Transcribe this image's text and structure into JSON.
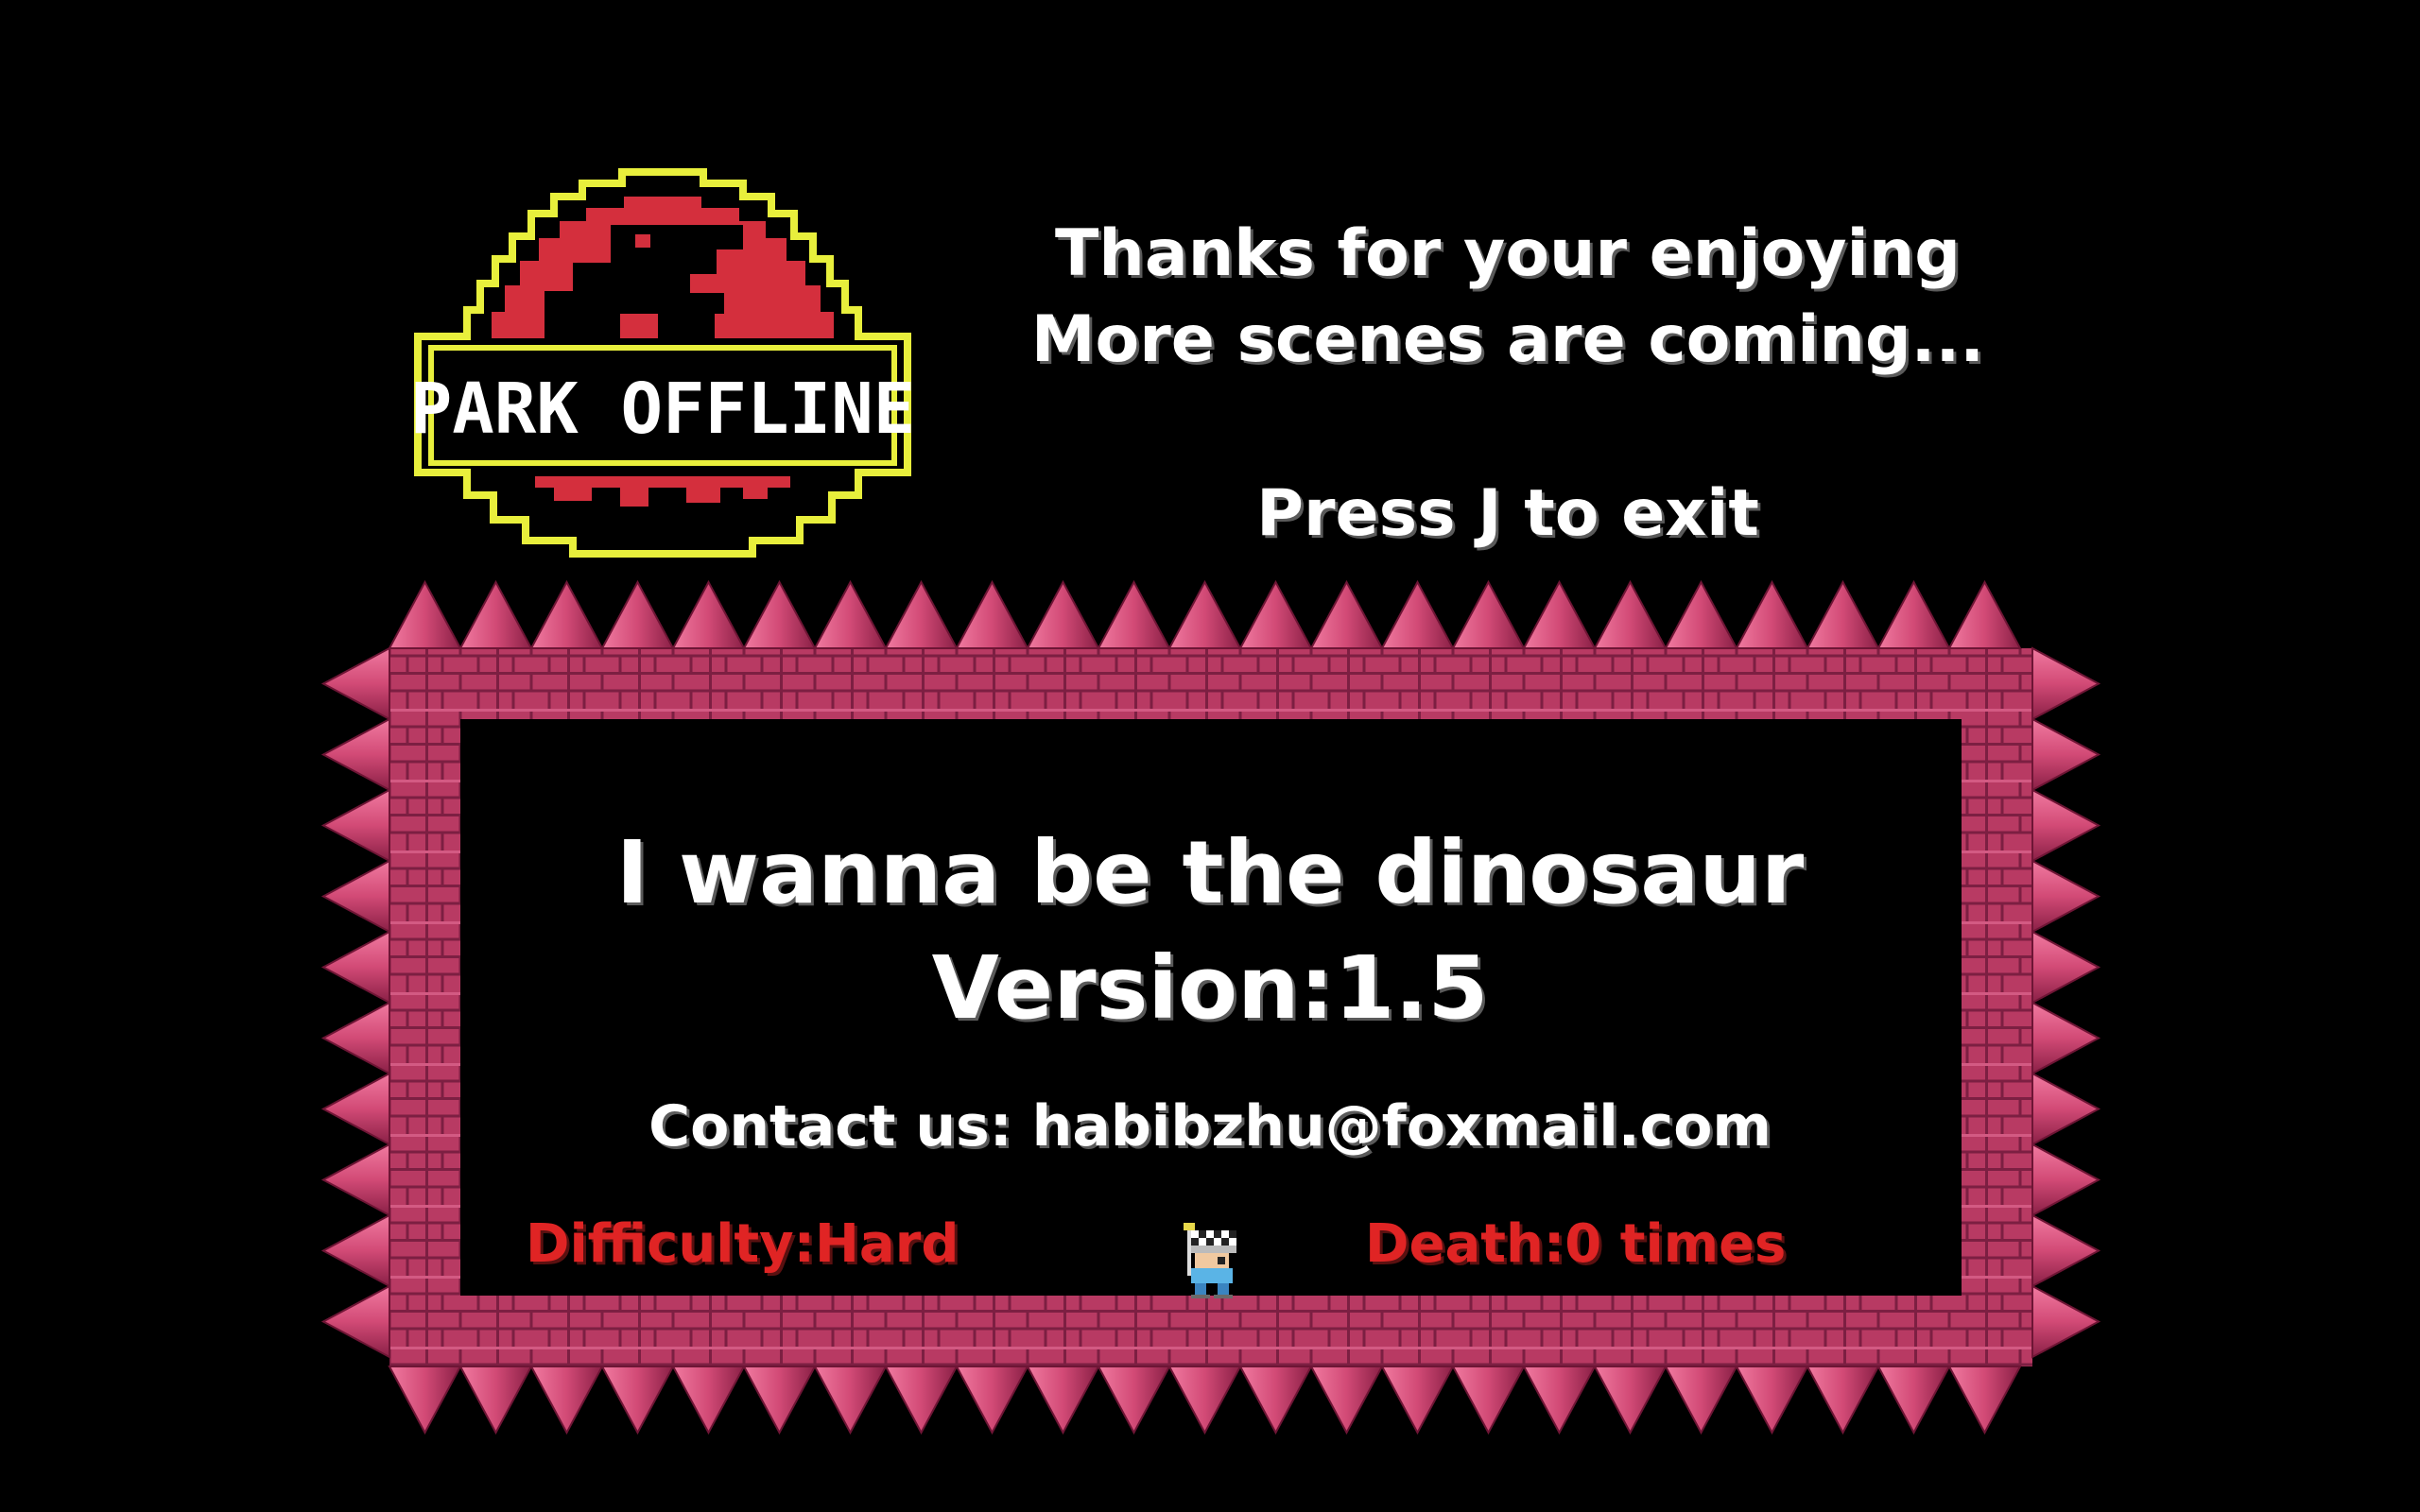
{
  "logo": {
    "text": "PARK OFFLINE",
    "accent_color": "#e8ef3c",
    "disc_color": "#d42f3d"
  },
  "messages": {
    "thanks_line_1": "Thanks for your enjoying",
    "thanks_line_2": "More scenes are coming...",
    "exit_hint": "Press J to exit"
  },
  "game": {
    "title": "I wanna be the dinosaur",
    "version": "Version:1.5",
    "contact": "Contact us: habibzhu@foxmail.com"
  },
  "status": {
    "difficulty": "Difficulty:Hard",
    "deaths": "Death:0 times"
  },
  "colors": {
    "background": "#000000",
    "brick": "#b83a63",
    "spike": "#d24a76",
    "text": "#ffffff",
    "status_text": "#e02424"
  },
  "icons": {
    "player": "kid-with-checkered-flag-icon"
  }
}
